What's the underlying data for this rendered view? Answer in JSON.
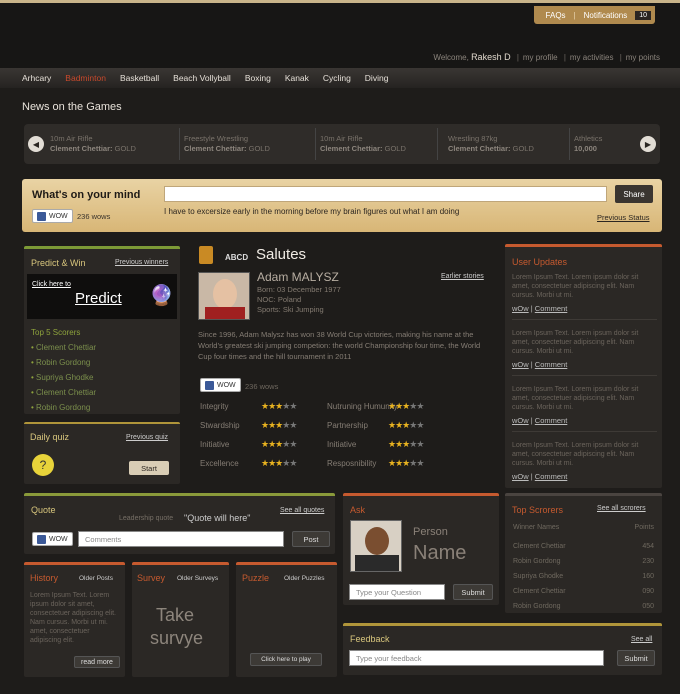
{
  "header": {
    "faqs": "FAQs",
    "notifications": "Notifications",
    "notif_count": "10",
    "welcome": "Welcome,",
    "user": "Rakesh D",
    "links": [
      "my profile",
      "my activities",
      "my points"
    ]
  },
  "sports_nav": [
    "Arhcary",
    "Badminton",
    "Basketball",
    "Beach Vollyball",
    "Boxing",
    "Kanak",
    "Cycling",
    "Diving"
  ],
  "news": {
    "title": "News on the Games",
    "items": [
      {
        "event": "10m Air Rifle",
        "person": "Clement Chettiar:",
        "medal": "GOLD"
      },
      {
        "event": "Freestyle Wrestling",
        "person": "Clement Chettiar:",
        "medal": "GOLD"
      },
      {
        "event": "10m Air Rifle",
        "person": "Clement Chettiar:",
        "medal": "GOLD"
      },
      {
        "event": "Wrestling 87kg",
        "person": "Clement Chettiar:",
        "medal": "GOLD"
      },
      {
        "event": "Athletics",
        "person": "10,000",
        "medal": ""
      }
    ]
  },
  "mind": {
    "title": "What's on your mind",
    "share": "Share",
    "status": "I have to excersize early in the morning before my brain figures out what I am doing",
    "prev_status": "Previous Status",
    "wow_label": "WOW",
    "wow_count": "236 wows"
  },
  "predict": {
    "title": "Predict & Win",
    "prev": "Previous winners",
    "click": "Click here to",
    "predict": "Predict",
    "scorers_title": "Top 5 Scorers",
    "scorers": [
      "Clement Chettiar",
      "Robin Gordong",
      "Supriya Ghodke",
      "Clement Chettiar",
      "Robin Gordong"
    ]
  },
  "quiz": {
    "title": "Daily quiz",
    "prev": "Previous quiz",
    "start": "Start"
  },
  "salutes": {
    "logo": "ABCD",
    "title": "Salutes",
    "name": "Adam MALYSZ",
    "born": "Born: 03 December 1977",
    "noc": "NOC: Poland",
    "sport": "Sports: Ski Jumping",
    "earlier": "Earlier stories",
    "bio": "Since 1996, Adam Malysz has won 38 World Cup victories, making his name at the World’s greatest ski jumping competion: the world Championship four time, the World Cup four times and the hill tournament in 2011",
    "wow_label": "WOW",
    "wow_count": "236 wows",
    "attrs_left": [
      {
        "label": "Integrity",
        "stars": 3
      },
      {
        "label": "Stwardship",
        "stars": 3
      },
      {
        "label": "Initiative",
        "stars": 3
      },
      {
        "label": "Excellence",
        "stars": 3
      }
    ],
    "attrs_right": [
      {
        "label": "Nutruning Humunity",
        "stars": 3
      },
      {
        "label": "Partnership",
        "stars": 3
      },
      {
        "label": "Initiative",
        "stars": 3
      },
      {
        "label": "Resposnibility",
        "stars": 3
      }
    ]
  },
  "updates": {
    "title": "User Updates",
    "text": "Lorem Ipsum Text. Lorem ipsum dolor sit amet, consectetuer adipiscing elit. Nam cursus. Morbi ut mi.",
    "wow": "wOw",
    "comment": "Comment"
  },
  "quote": {
    "title": "Quote",
    "see_all": "See all quotes",
    "label": "Leadership quote",
    "text": "\"Quote will here\"",
    "wow_label": "WOW",
    "comments_placeholder": "Comments",
    "post": "Post"
  },
  "ask": {
    "title": "Ask",
    "person": "Person",
    "name": "Name",
    "placeholder": "Type your Question",
    "submit": "Submit"
  },
  "scorers": {
    "title": "Top Scrorers",
    "see_all": "See all scrorers",
    "col_name": "Winner Names",
    "col_points": "Points",
    "rows": [
      {
        "name": "Clement Chettiar",
        "points": "454"
      },
      {
        "name": "Robin Gordong",
        "points": "230"
      },
      {
        "name": "Supriya Ghodke",
        "points": "160"
      },
      {
        "name": "Clement Chettiar",
        "points": "090"
      },
      {
        "name": "Robin Gordong",
        "points": "050"
      }
    ]
  },
  "history": {
    "title": "History",
    "link": "Older Posts",
    "text": "Lorem Ipsum Text. Lorem ipsum dolor sit amet, consectetuer adipiscing elit. Nam cursus. Morbi ut mi. amet, consectetuer adipiscing elit.",
    "more": "read more"
  },
  "survey": {
    "title": "Survey",
    "link": "Older Surveys",
    "take": "Take",
    "survye": "survye"
  },
  "puzzle": {
    "title": "Puzzle",
    "link": "Older Puzzles",
    "play": "Click here to play"
  },
  "feedback": {
    "title": "Feedback",
    "see_all": "See all",
    "placeholder": "Type your feedback",
    "submit": "Submit"
  },
  "colors": {
    "accent_gold": "#d8b676",
    "accent_orange": "#c65a2f",
    "accent_green": "#7d9a36",
    "star": "#e9b320"
  }
}
